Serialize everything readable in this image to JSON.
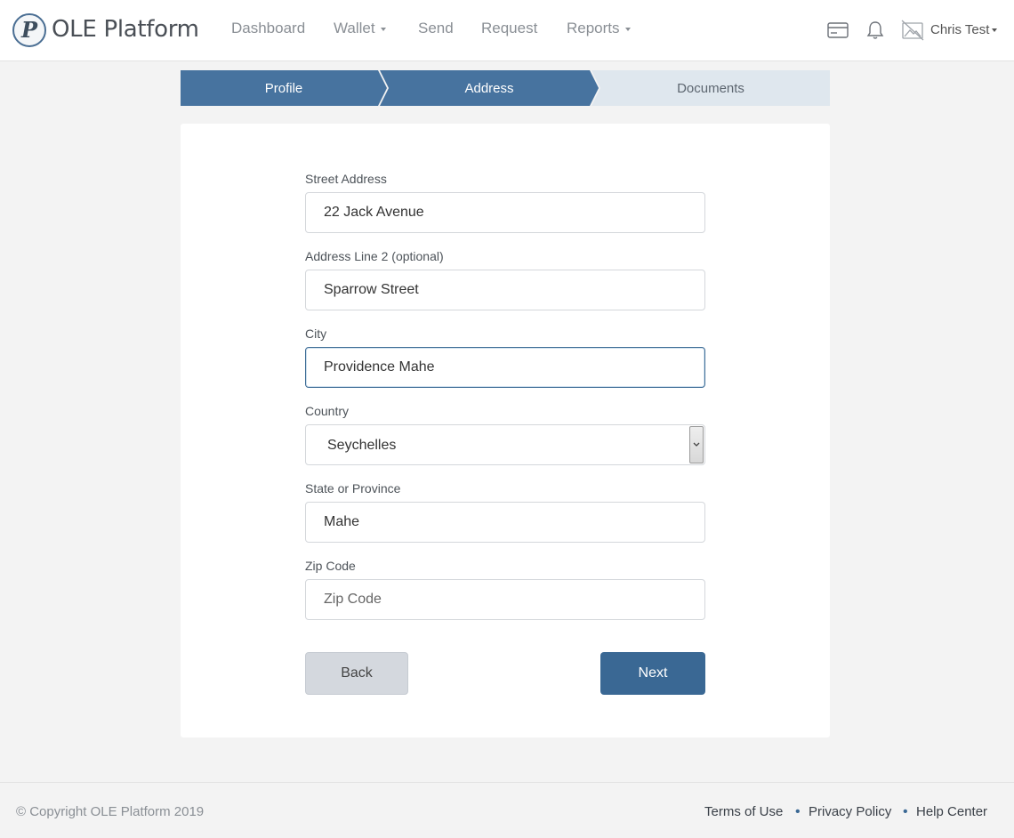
{
  "app": {
    "brand": "OLE Platform",
    "logo_letter": "P"
  },
  "nav": {
    "dashboard": "Dashboard",
    "wallet": "Wallet",
    "send": "Send",
    "request": "Request",
    "reports": "Reports"
  },
  "user": {
    "name": "Chris Test"
  },
  "icons": {
    "card": "credit-card-icon",
    "bell": "bell-icon",
    "avatar": "avatar-placeholder-icon"
  },
  "stepper": {
    "steps": [
      {
        "label": "Profile",
        "state": "complete"
      },
      {
        "label": "Address",
        "state": "active"
      },
      {
        "label": "Documents",
        "state": "pending"
      }
    ]
  },
  "form": {
    "street": {
      "label": "Street Address",
      "value": "22 Jack Avenue",
      "placeholder": "Street Address"
    },
    "line2": {
      "label": "Address Line 2 (optional)",
      "value": "Sparrow Street",
      "placeholder": "Address Line 2"
    },
    "city": {
      "label": "City",
      "value": "Providence Mahe",
      "placeholder": "City"
    },
    "country": {
      "label": "Country",
      "value": "Seychelles"
    },
    "state": {
      "label": "State or Province",
      "value": "Mahe",
      "placeholder": "State or Province"
    },
    "zip": {
      "label": "Zip Code",
      "value": "",
      "placeholder": "Zip Code"
    },
    "back_label": "Back",
    "next_label": "Next"
  },
  "footer": {
    "copyright": "© Copyright OLE Platform 2019",
    "links": [
      "Terms of Use",
      "Privacy Policy",
      "Help Center"
    ]
  },
  "colors": {
    "accent": "#47739f",
    "primary_button": "#3a6894",
    "step_pending": "#dfe7ee"
  }
}
